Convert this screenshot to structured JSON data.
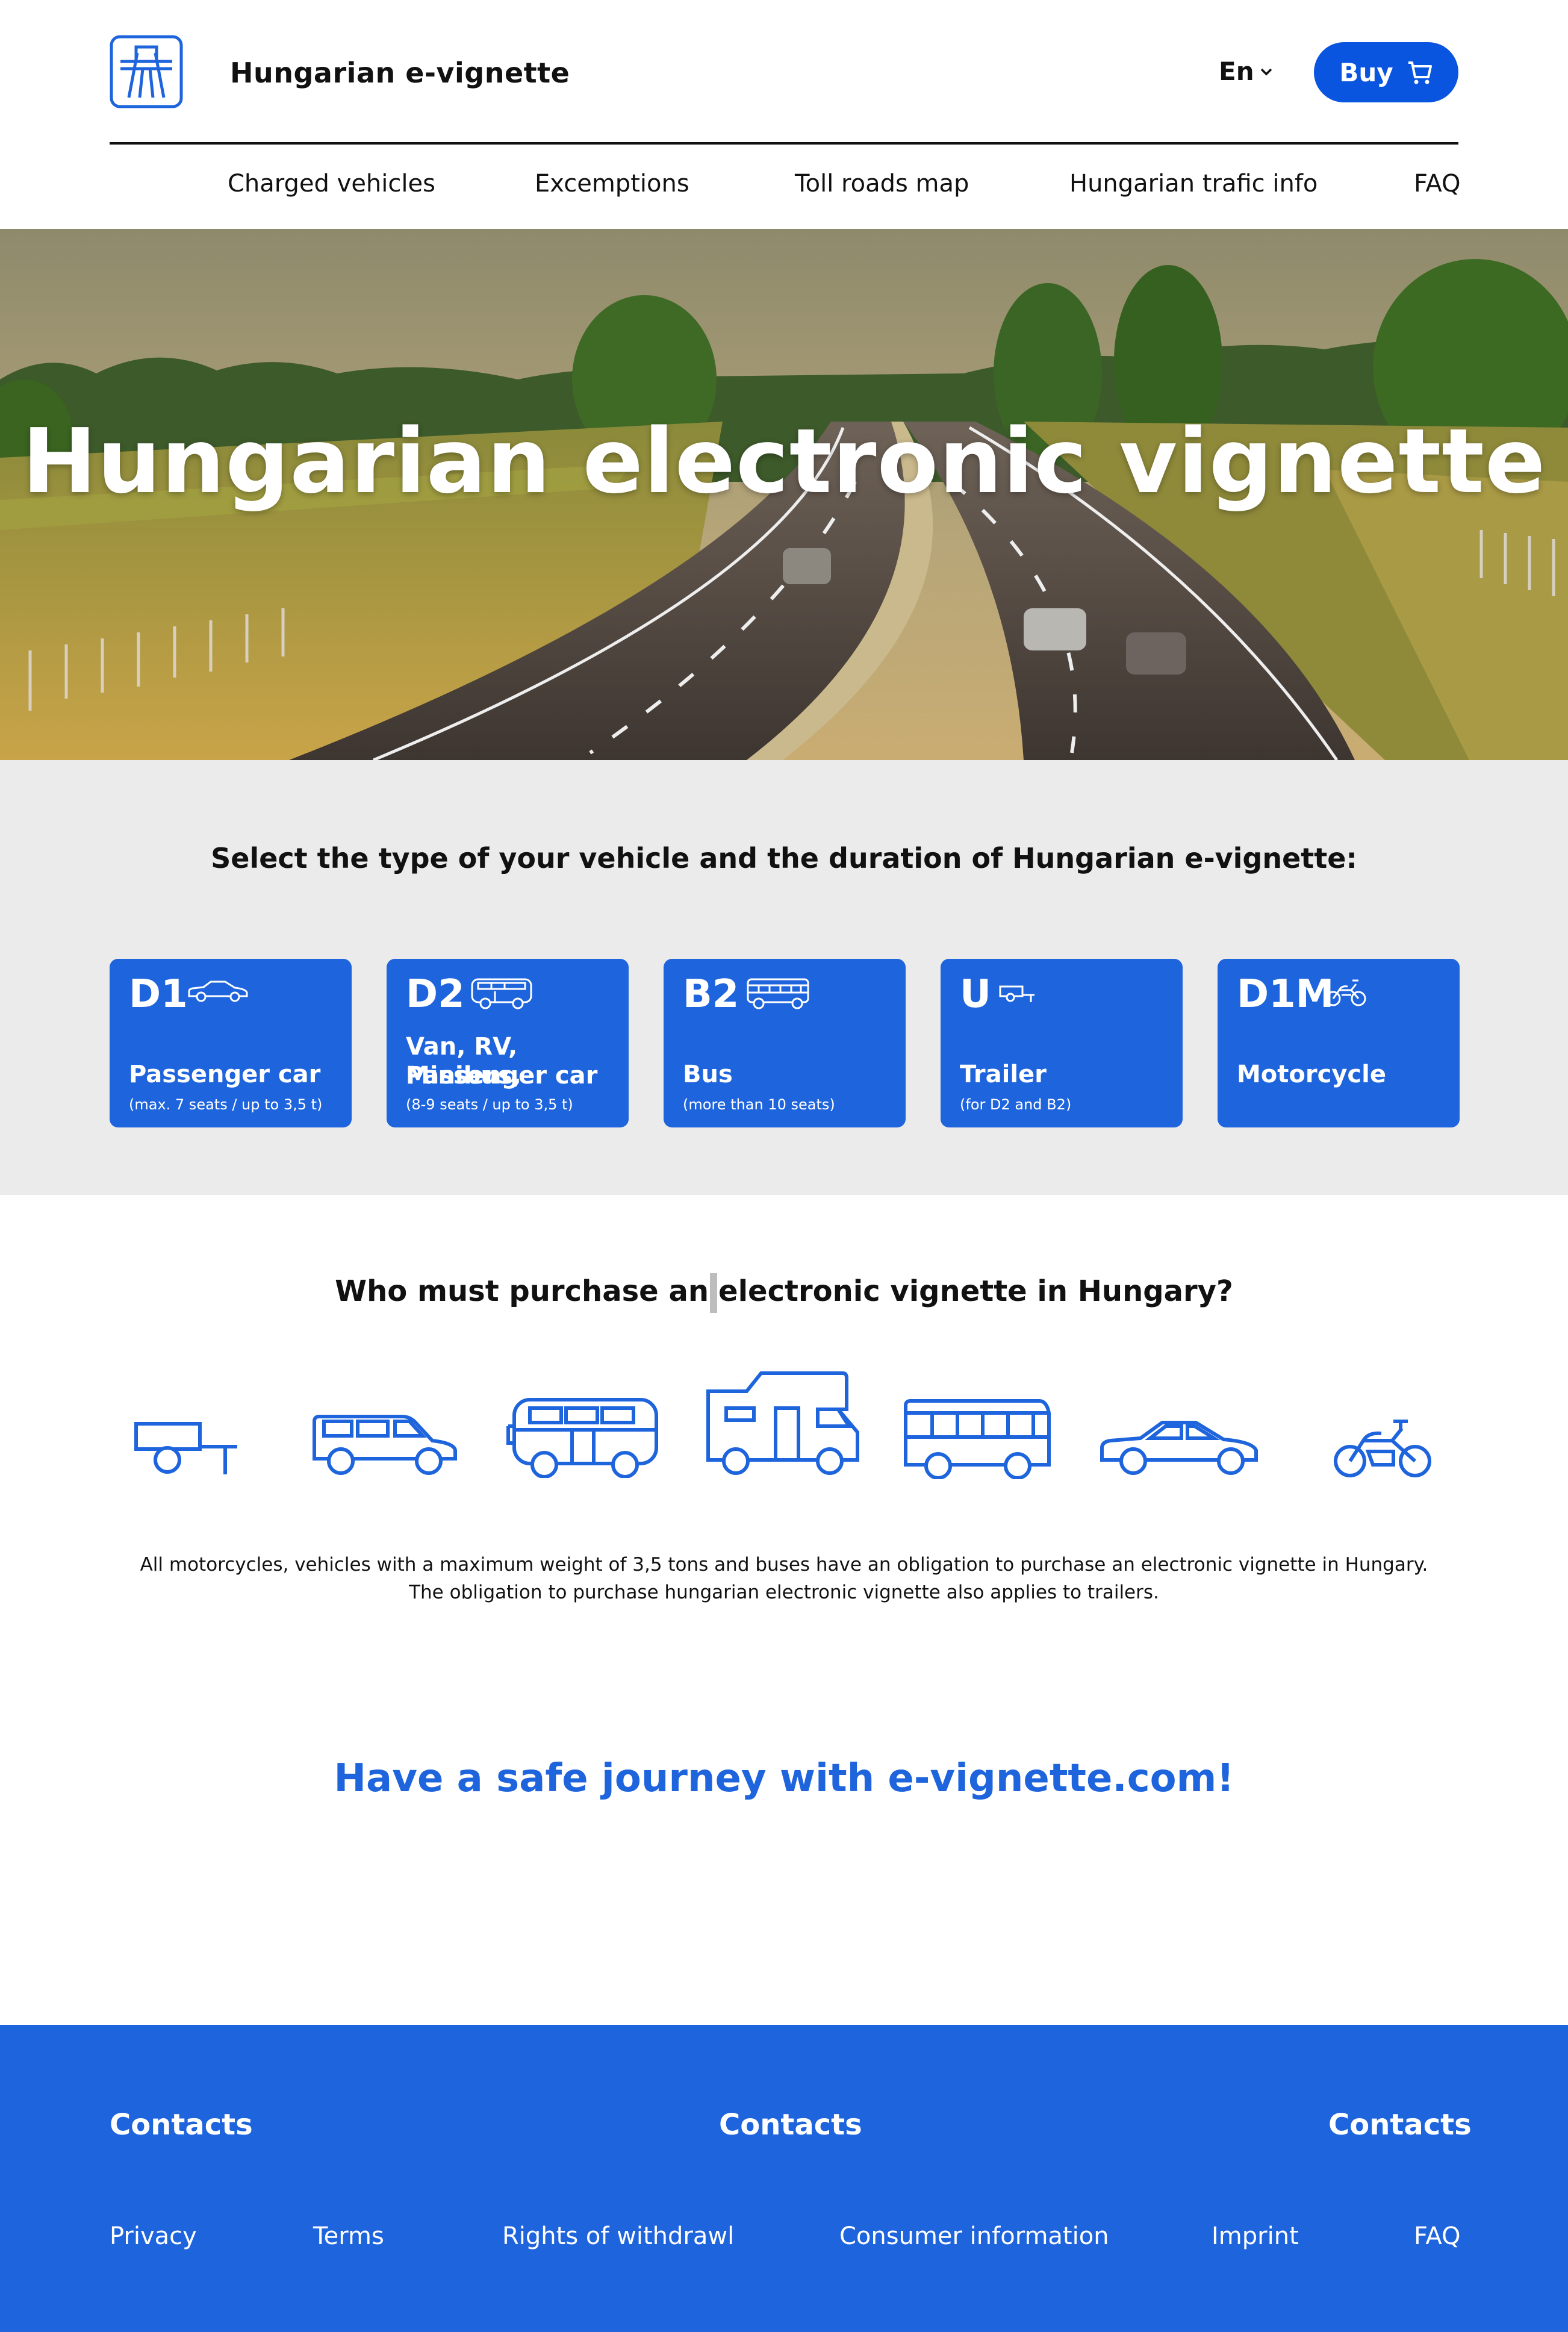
{
  "header": {
    "site_title": "Hungarian e-vignette",
    "language": "En",
    "buy_label": "Buy"
  },
  "nav": {
    "items": [
      "Charged vehicles",
      "Excemptions",
      "Toll roads map",
      "Hungarian trafic info",
      "FAQ"
    ]
  },
  "hero": {
    "title": "Hungarian electronic vignette"
  },
  "select": {
    "title": "Select the type of your vehicle and the duration of Hungarian e-vignette:",
    "cards": [
      {
        "code": "D1",
        "icon": "car-icon",
        "name_line1": "Passenger car",
        "name_line2": "",
        "note": "(max. 7 seats / up to 3,5 t)"
      },
      {
        "code": "D2",
        "icon": "van-icon",
        "name_line1": "Van, RV, Minibus,",
        "name_line2": "Passenger car",
        "note": "(8-9 seats / up to 3,5 t)"
      },
      {
        "code": "B2",
        "icon": "bus-icon",
        "name_line1": "Bus",
        "name_line2": "",
        "note": "(more than 10 seats)"
      },
      {
        "code": "U",
        "icon": "trailer-icon",
        "name_line1": "Trailer",
        "name_line2": "",
        "note": "(for D2 and B2)"
      },
      {
        "code": "D1M",
        "icon": "motorcycle-icon",
        "name_line1": "Motorcycle",
        "name_line2": "",
        "note": ""
      }
    ]
  },
  "who": {
    "title_part1": "Who must purchase an",
    "title_part2": "electronic vignette in Hungary?",
    "vehicle_icons": [
      "trailer-icon",
      "van-icon",
      "minibus-icon",
      "camper-icon",
      "bus-icon",
      "car-icon",
      "motorcycle-icon"
    ],
    "text_line1": "All motorcycles, vehicles with a maximum weight of 3,5 tons and buses have an obligation to purchase an electronic vignette in Hungary.",
    "text_line2": "The obligation to purchase hungarian electronic vignette also applies to trailers."
  },
  "safe_journey": "Have a safe journey with e-vignette.com!",
  "footer": {
    "headings": [
      "Contacts",
      "Contacts",
      "Contacts"
    ],
    "links": [
      "Privacy",
      "Terms",
      "Rights of withdrawl",
      "Consumer information",
      "Imprint",
      "FAQ"
    ]
  },
  "colors": {
    "brand_blue": "#1e64dc",
    "button_blue": "#0a55e0",
    "section_gray": "#ebebeb"
  }
}
